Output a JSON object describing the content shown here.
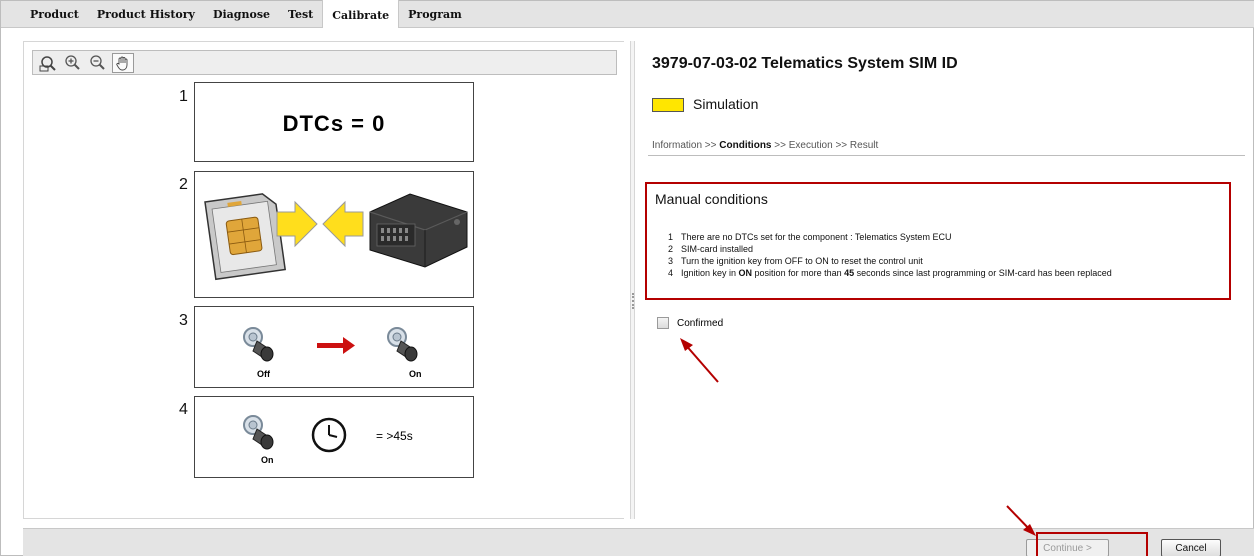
{
  "menu": {
    "tabs": [
      {
        "label": "Product"
      },
      {
        "label": "Product History"
      },
      {
        "label": "Diagnose"
      },
      {
        "label": "Test"
      },
      {
        "label": "Calibrate"
      },
      {
        "label": "Program"
      }
    ],
    "active_tab": "Calibrate"
  },
  "left_pane": {
    "toolbar_icons": [
      "zoom-fit-icon",
      "zoom-in-icon",
      "zoom-out-icon",
      "pan-hand-icon"
    ],
    "steps": [
      {
        "number": "1",
        "text": "DTCs = 0"
      },
      {
        "number": "2"
      },
      {
        "number": "3",
        "off_label": "Off",
        "on_label": "On"
      },
      {
        "number": "4",
        "on_label": "On",
        "time_label": "= >45s"
      }
    ]
  },
  "right_pane": {
    "title": "3979-07-03-02 Telematics System SIM ID",
    "mode_label": "Simulation",
    "breadcrumb": {
      "step1": "Information",
      "sep1": " >> ",
      "step2": "Conditions",
      "sep2": " >> ",
      "step3": "Execution",
      "sep3": " >> ",
      "step4": "Result"
    },
    "conditions": {
      "title": "Manual conditions",
      "items": [
        {
          "num": "1",
          "text": "There are no DTCs set for the component : Telematics System ECU"
        },
        {
          "num": "2",
          "text": "SIM-card installed"
        },
        {
          "num": "3",
          "text": "Turn the ignition key from OFF to ON to reset the control unit"
        },
        {
          "num": "4",
          "pre": "Ignition key in ",
          "bold1": "ON",
          "mid": " position for more than ",
          "bold2": "45",
          "post": " seconds since last programming or SIM-card has been replaced"
        }
      ]
    },
    "confirm_label": "Confirmed",
    "confirmed": false
  },
  "footer": {
    "continue_label": "Continue >",
    "cancel_label": "Cancel"
  },
  "colors": {
    "highlight": "#b40000",
    "simulation": "#ffe600",
    "menu_bg": "#e4e4e4"
  }
}
